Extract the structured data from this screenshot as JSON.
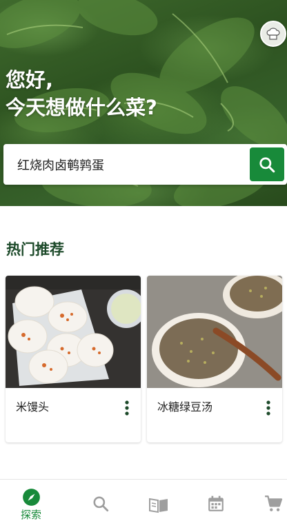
{
  "hero": {
    "greeting_line1": "您好,",
    "greeting_line2": "今天想做什么菜?"
  },
  "search": {
    "value": "红烧肉卤鹌鹑蛋"
  },
  "section": {
    "title": "热门推荐"
  },
  "recipes": [
    {
      "name": "米馒头"
    },
    {
      "name": "冰糖绿豆汤"
    }
  ],
  "nav": {
    "items": [
      {
        "label": "探索",
        "icon": "compass-icon",
        "active": true
      },
      {
        "label": "",
        "icon": "search-icon",
        "active": false
      },
      {
        "label": "",
        "icon": "book-icon",
        "active": false
      },
      {
        "label": "",
        "icon": "calendar-icon",
        "active": false
      },
      {
        "label": "",
        "icon": "cart-icon",
        "active": false
      }
    ]
  },
  "colors": {
    "accent": "#188a3a",
    "section_title": "#1d4a2a",
    "icon_inactive": "#9e9e9e"
  }
}
